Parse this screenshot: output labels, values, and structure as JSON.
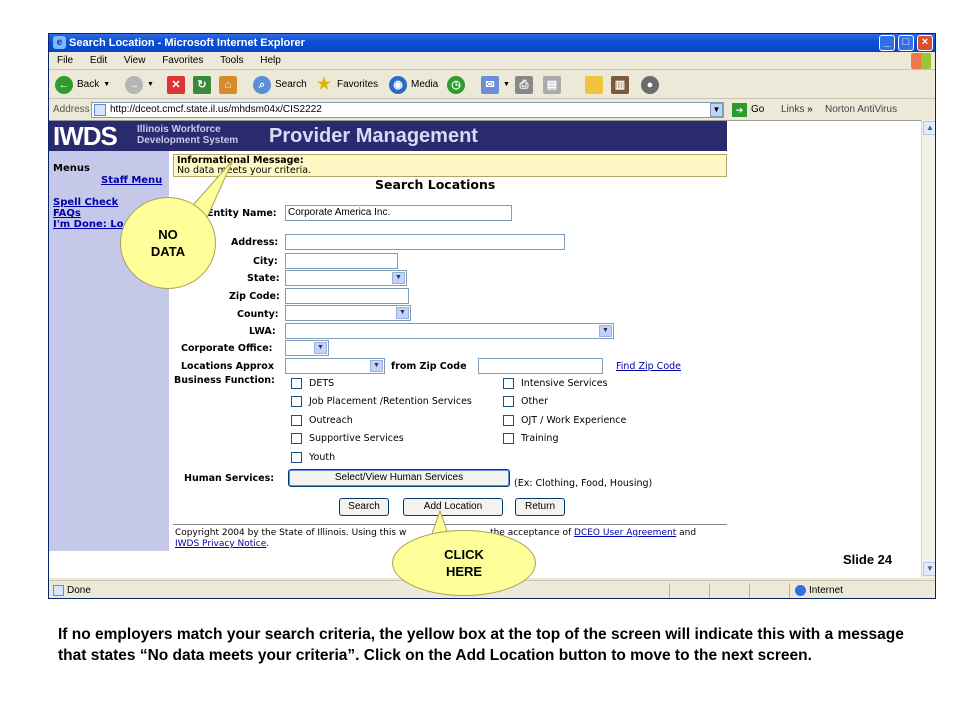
{
  "browser": {
    "window_title": "Search Location - Microsoft Internet Explorer",
    "menu": [
      "File",
      "Edit",
      "View",
      "Favorites",
      "Tools",
      "Help"
    ],
    "toolbar": {
      "back": "Back",
      "search": "Search",
      "favorites": "Favorites",
      "media": "Media"
    },
    "address_label": "Address",
    "url": "http://dceot.cmcf.state.il.us/mhdsm04x/CIS2222",
    "go": "Go",
    "links": "Links",
    "links_more": "»",
    "norton": "Norton AntiVirus",
    "status": "Done",
    "zone": "Internet"
  },
  "banner": {
    "logo": "IWDS",
    "sub_line1": "Illinois Workforce",
    "sub_line2": "Development System",
    "title": "Provider Management"
  },
  "nav": {
    "menus_label": "Menus",
    "staff_menu": "Staff Menu",
    "spell_check": "Spell Check",
    "faqs": "FAQs",
    "im_done": "I'm Done: Lo"
  },
  "info": {
    "title": "Informational Message:",
    "message": "No data meets your criteria."
  },
  "page_title": "Search Locations",
  "form": {
    "entity_name_label": "Entity Name:",
    "entity_name_value": "Corporate America Inc.",
    "address_label": "Address:",
    "city_label": "City:",
    "state_label": "State:",
    "zip_label": "Zip Code:",
    "county_label": "County:",
    "lwa_label": "LWA:",
    "corporate_office_label": "Corporate Office:",
    "locations_approx_label": "Locations Approx",
    "from_zip_label": "from Zip Code",
    "find_zip_link": "Find Zip Code",
    "business_function_label": "Business Function:",
    "business_functions": {
      "dets": "DETS",
      "job_placement": "Job Placement /Retention Services",
      "outreach": "Outreach",
      "supportive": "Supportive Services",
      "youth": "Youth",
      "intensive": "Intensive Services",
      "other": "Other",
      "ojt": "OJT / Work Experience",
      "training": "Training"
    },
    "human_services_label": "Human Services:",
    "human_services_button": "Select/View Human Services",
    "human_services_hint": "(Ex: Clothing, Food, Housing)",
    "search_button": "Search",
    "add_location_button": "Add Location",
    "return_button": "Return"
  },
  "footer": {
    "text1": "Copyright 2004 by the State of Illinois. Using this w",
    "text2": "the acceptance of",
    "agreement_link": "DCEO User Agreement",
    "and": "and",
    "privacy_link": "IWDS Privacy Notice",
    "period": "."
  },
  "callouts": {
    "no_data_line1": "NO",
    "no_data_line2": "DATA",
    "click_here_line1": "CLICK",
    "click_here_line2": "HERE"
  },
  "slide_number": "Slide 24",
  "caption": "If no employers match your search criteria,  the yellow box at the top of the screen will indicate this with a message that states “No data meets your criteria”.  Click on the Add Location button to move to the next screen.",
  "colors": {
    "banner_bg": "#2a2a6e",
    "nav_bg": "#c6c8ea",
    "info_bg": "#fff8c4",
    "callout_bg": "#ffff99",
    "titlebar": "#0a4fd4"
  }
}
